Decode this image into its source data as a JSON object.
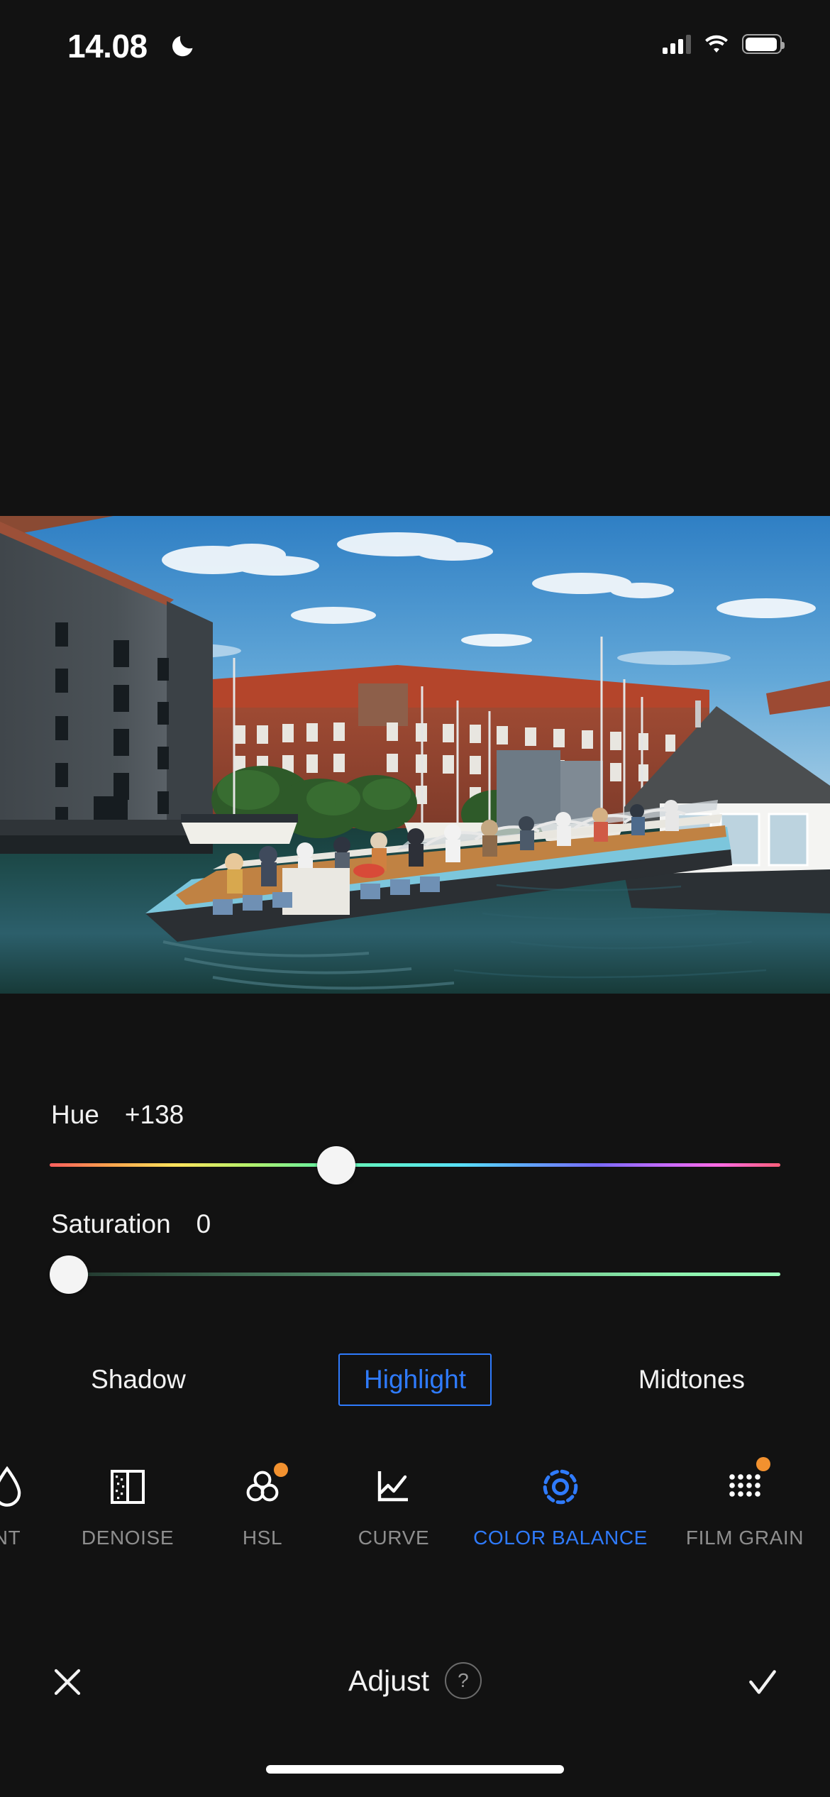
{
  "status_bar": {
    "time": "14.08",
    "dnd_icon": "crescent-moon-icon",
    "cellular_icon": "signal-bars-icon",
    "cellular_bars_filled": 3,
    "cellular_bars_total": 4,
    "wifi_icon": "wifi-icon",
    "battery_icon": "battery-icon",
    "battery_level_percent": 85
  },
  "photo": {
    "alt": "Copenhagen canal scene with tour boat, brick buildings and houseboat"
  },
  "adjustments": {
    "hue": {
      "label": "Hue",
      "value": "+138",
      "position_percent": 37,
      "gradient": "rainbow-hue"
    },
    "saturation": {
      "label": "Saturation",
      "value": "0",
      "position_percent": 0,
      "gradient": "green-saturation"
    }
  },
  "tone_tabs": {
    "items": [
      {
        "label": "Shadow",
        "selected": false
      },
      {
        "label": "Highlight",
        "selected": true
      },
      {
        "label": "Midtones",
        "selected": false
      }
    ],
    "accent_color": "#2f7bfd"
  },
  "tools": {
    "items": [
      {
        "label": "NT",
        "icon": "droplet-icon",
        "active": false,
        "badge": false
      },
      {
        "label": "DENOISE",
        "icon": "denoise-split-panel-icon",
        "active": false,
        "badge": false
      },
      {
        "label": "HSL",
        "icon": "three-circles-icon",
        "active": false,
        "badge": true
      },
      {
        "label": "CURVE",
        "icon": "curve-graph-icon",
        "active": false,
        "badge": false
      },
      {
        "label": "COLOR BALANCE",
        "icon": "color-balance-target-icon",
        "active": true,
        "badge": false
      },
      {
        "label": "FILM GRAIN",
        "icon": "dot-grid-icon",
        "active": false,
        "badge": true
      }
    ],
    "badge_color": "#f2912f",
    "inactive_color": "#8e8e8e",
    "active_color": "#2f7bfd"
  },
  "bottom_bar": {
    "cancel_icon": "close-x-icon",
    "title": "Adjust",
    "help_label": "?",
    "confirm_icon": "checkmark-icon"
  }
}
